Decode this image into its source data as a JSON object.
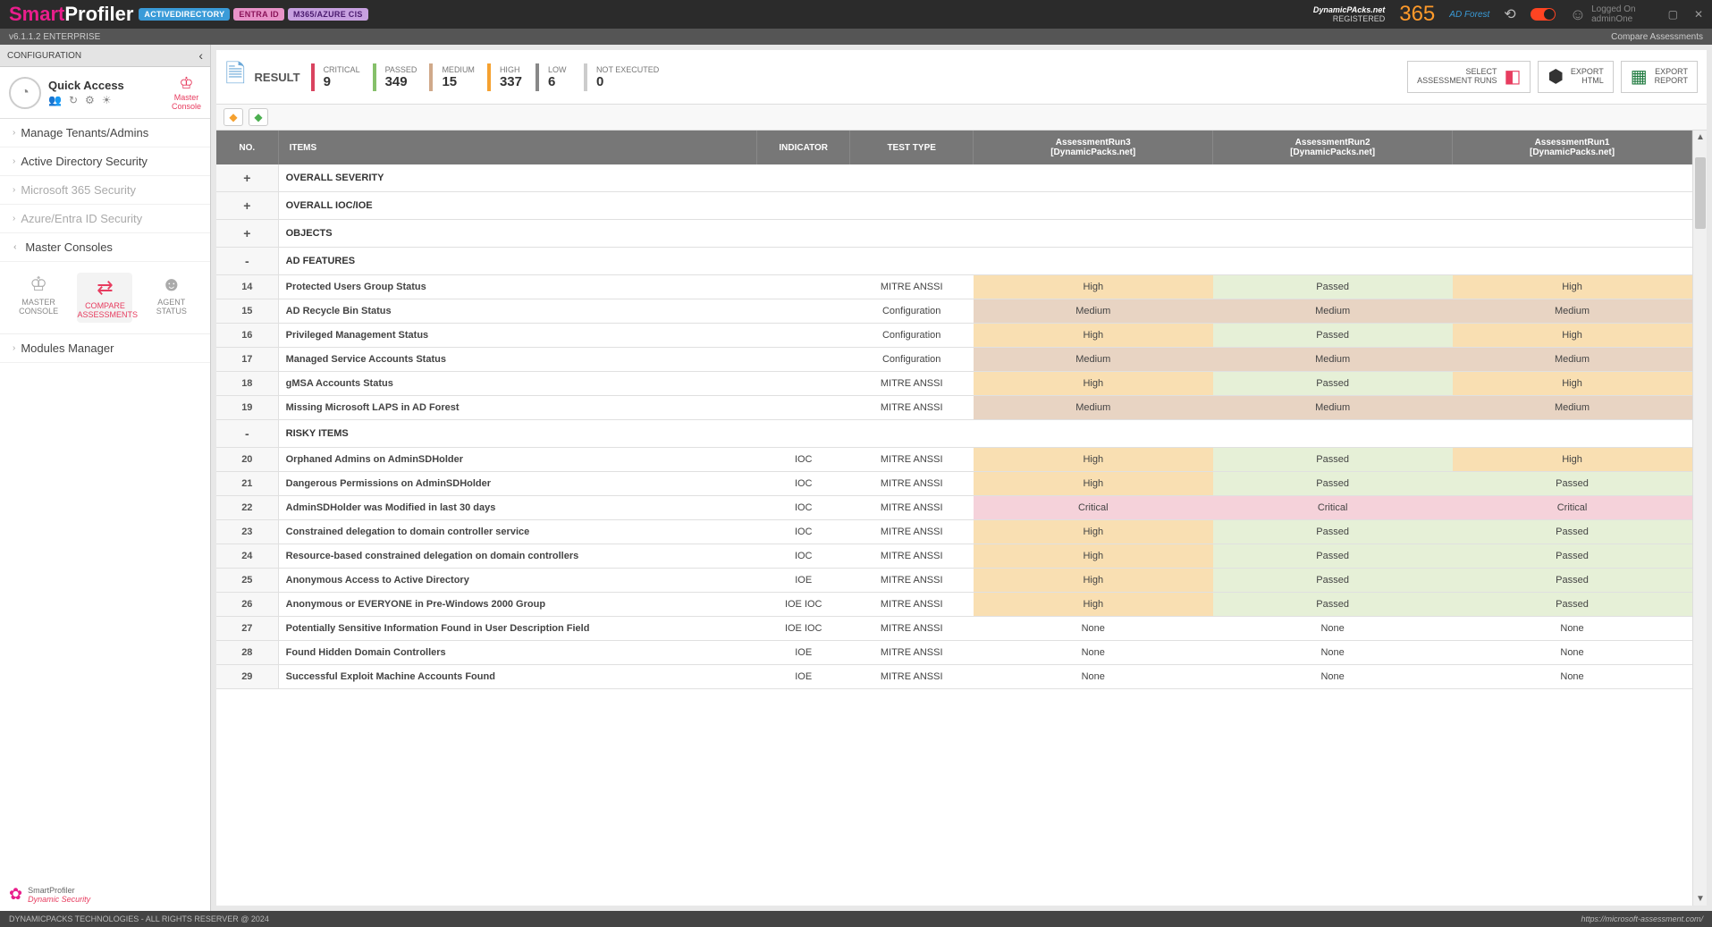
{
  "brand": {
    "p1": "Smart",
    "p2": "Profiler"
  },
  "badges": {
    "ad": "ACTIVEDIRECTORY",
    "entra": "ENTRA ID",
    "m365": "M365/AZURE CIS"
  },
  "header": {
    "org": "DynamicPAcks.net",
    "reg": "REGISTERED",
    "big": "365",
    "forest": "AD Forest",
    "loggedon": "Logged On",
    "user": "adminOne"
  },
  "subbar": {
    "ver": "v6.1.1.2  ENTERPRISE",
    "right": "Compare Assessments"
  },
  "sidebar": {
    "config": "CONFIGURATION",
    "quick": "Quick Access",
    "masterconsole": "Master\nConsole",
    "nav": [
      {
        "label": "Manage Tenants/Admins",
        "dim": false
      },
      {
        "label": "Active Directory Security",
        "dim": false
      },
      {
        "label": "Microsoft 365 Security",
        "dim": true
      },
      {
        "label": "Azure/Entra ID Security",
        "dim": true
      }
    ],
    "master": "Master Consoles",
    "consoles": [
      {
        "label": "MASTER\nCONSOLE"
      },
      {
        "label": "COMPARE\nASSESSMENTS"
      },
      {
        "label": "AGENT\nSTATUS"
      }
    ],
    "modules": "Modules Manager",
    "footer": {
      "t1": "SmartProfiler",
      "t2": "Dynamic Security"
    }
  },
  "toolbar": {
    "result": "RESULT",
    "stats": {
      "critical": {
        "lbl": "CRITICAL",
        "val": "9"
      },
      "passed": {
        "lbl": "PASSED",
        "val": "349"
      },
      "medium": {
        "lbl": "MEDIUM",
        "val": "15"
      },
      "high": {
        "lbl": "HIGH",
        "val": "337"
      },
      "low": {
        "lbl": "LOW",
        "val": "6"
      },
      "ne": {
        "lbl": "NOT EXECUTED",
        "val": "0"
      }
    },
    "btns": {
      "select": "SELECT\nASSESSMENT RUNS",
      "html": "EXPORT\nHTML",
      "report": "EXPORT\nREPORT"
    }
  },
  "table": {
    "headers": {
      "no": "NO.",
      "items": "ITEMS",
      "indicator": "INDICATOR",
      "testtype": "TEST TYPE",
      "run3": "AssessmentRun3\n[DynamicPacks.net]",
      "run2": "AssessmentRun2\n[DynamicPacks.net]",
      "run1": "AssessmentRun1\n[DynamicPacks.net]"
    },
    "sections": [
      {
        "exp": "+",
        "title": "OVERALL SEVERITY"
      },
      {
        "exp": "+",
        "title": "OVERALL IOC/IOE"
      },
      {
        "exp": "+",
        "title": "OBJECTS"
      },
      {
        "exp": "-",
        "title": "AD FEATURES",
        "rows": [
          {
            "no": "14",
            "item": "Protected Users Group Status",
            "ind": "",
            "tt": "MITRE ANSSI",
            "r3": "High",
            "r2": "Passed",
            "r1": "High"
          },
          {
            "no": "15",
            "item": "AD Recycle Bin Status",
            "ind": "",
            "tt": "Configuration",
            "r3": "Medium",
            "r2": "Medium",
            "r1": "Medium"
          },
          {
            "no": "16",
            "item": "Privileged Management Status",
            "ind": "",
            "tt": "Configuration",
            "r3": "High",
            "r2": "Passed",
            "r1": "High"
          },
          {
            "no": "17",
            "item": "Managed Service Accounts Status",
            "ind": "",
            "tt": "Configuration",
            "r3": "Medium",
            "r2": "Medium",
            "r1": "Medium"
          },
          {
            "no": "18",
            "item": "gMSA Accounts Status",
            "ind": "",
            "tt": "MITRE ANSSI",
            "r3": "High",
            "r2": "Passed",
            "r1": "High"
          },
          {
            "no": "19",
            "item": "Missing Microsoft LAPS in AD Forest",
            "ind": "",
            "tt": "MITRE ANSSI",
            "r3": "Medium",
            "r2": "Medium",
            "r1": "Medium"
          }
        ]
      },
      {
        "exp": "-",
        "title": "RISKY ITEMS",
        "rows": [
          {
            "no": "20",
            "item": "Orphaned Admins on AdminSDHolder",
            "ind": "IOC",
            "tt": "MITRE ANSSI",
            "r3": "High",
            "r2": "Passed",
            "r1": "High"
          },
          {
            "no": "21",
            "item": "Dangerous Permissions on AdminSDHolder",
            "ind": "IOC",
            "tt": "MITRE ANSSI",
            "r3": "High",
            "r2": "Passed",
            "r1": "Passed"
          },
          {
            "no": "22",
            "item": "AdminSDHolder was Modified in last 30 days",
            "ind": "IOC",
            "tt": "MITRE ANSSI",
            "r3": "Critical",
            "r2": "Critical",
            "r1": "Critical"
          },
          {
            "no": "23",
            "item": "Constrained delegation to domain controller service",
            "ind": "IOC",
            "tt": "MITRE ANSSI",
            "r3": "High",
            "r2": "Passed",
            "r1": "Passed"
          },
          {
            "no": "24",
            "item": "Resource-based constrained delegation on domain controllers",
            "ind": "IOC",
            "tt": "MITRE ANSSI",
            "r3": "High",
            "r2": "Passed",
            "r1": "Passed"
          },
          {
            "no": "25",
            "item": "Anonymous Access to Active Directory",
            "ind": "IOE",
            "tt": "MITRE ANSSI",
            "r3": "High",
            "r2": "Passed",
            "r1": "Passed"
          },
          {
            "no": "26",
            "item": "Anonymous or EVERYONE in Pre-Windows 2000 Group",
            "ind": "IOE IOC",
            "tt": "MITRE ANSSI",
            "r3": "High",
            "r2": "Passed",
            "r1": "Passed"
          },
          {
            "no": "27",
            "item": "Potentially Sensitive Information Found in User Description Field",
            "ind": "IOE IOC",
            "tt": "MITRE ANSSI",
            "r3": "None",
            "r2": "None",
            "r1": "None"
          },
          {
            "no": "28",
            "item": "Found Hidden Domain Controllers",
            "ind": "IOE",
            "tt": "MITRE ANSSI",
            "r3": "None",
            "r2": "None",
            "r1": "None"
          },
          {
            "no": "29",
            "item": "Successful Exploit Machine Accounts Found",
            "ind": "IOE",
            "tt": "MITRE ANSSI",
            "r3": "None",
            "r2": "None",
            "r1": "None"
          }
        ]
      }
    ]
  },
  "bottombar": {
    "left": "DYNAMICPACKS TECHNOLOGIES - ALL RIGHTS RESERVER @ 2024",
    "right": "https://microsoft-assessment.com/"
  }
}
